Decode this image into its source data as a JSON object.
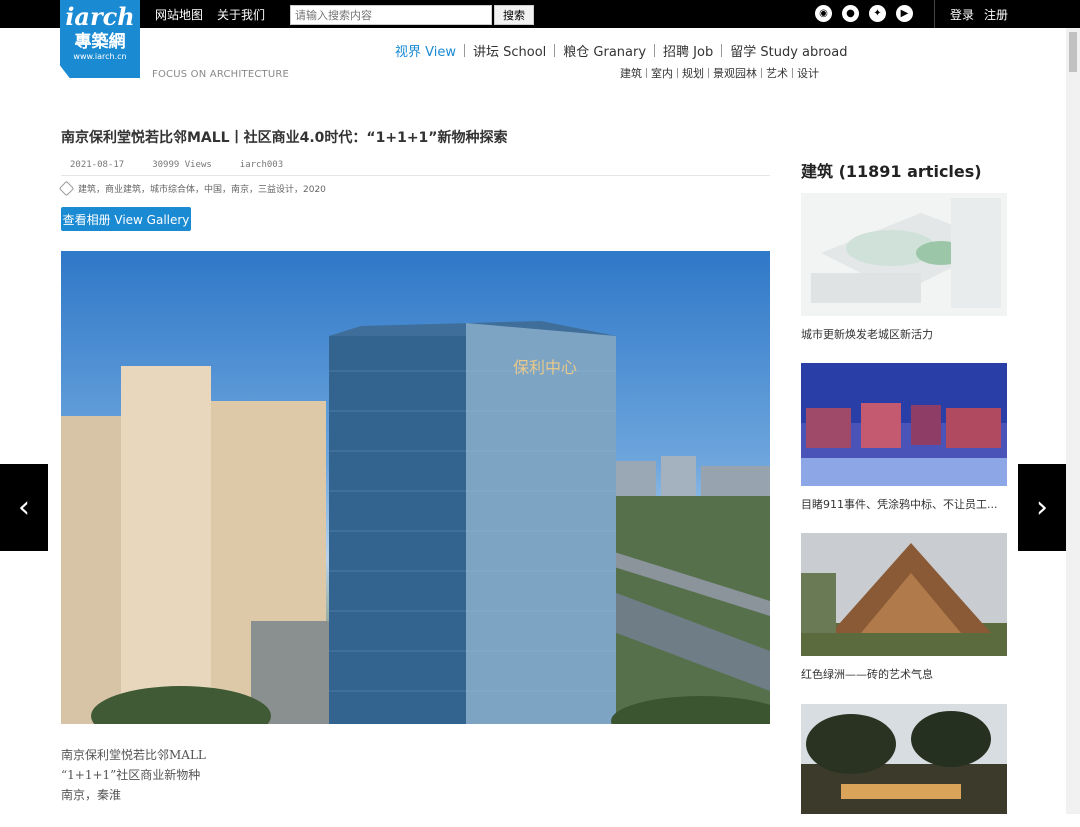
{
  "topbar": {
    "links": [
      "网站地图",
      "关于我们"
    ],
    "search_placeholder": "请输入搜索内容",
    "search_button": "搜索",
    "login": "登录",
    "register": "注册"
  },
  "logo": {
    "text1": "iarch",
    "text2": "專築網",
    "text3": "www.iarch.cn",
    "tagline": "FOCUS ON ARCHITECTURE"
  },
  "mainnav": [
    "视界 View",
    "讲坛 School",
    "粮仓 Granary",
    "招聘 Job",
    "留学 Study abroad"
  ],
  "subnav": [
    "建筑",
    "室内",
    "规划",
    "景观园林",
    "艺术",
    "设计"
  ],
  "article": {
    "title": "南京保利堂悦若比邻MALL丨社区商业4.0时代：“1+1+1”新物种探索",
    "date": "2021-08-17",
    "views": "30999 Views",
    "author": "iarch003",
    "tags": "建筑，商业建筑，城市综合体，中国，南京，三益设计，2020",
    "gallery_button": "查看相册 View Gallery",
    "caption_lines": [
      "南京保利堂悦若比邻MALL",
      "“1+1+1”社区商业新物种",
      "南京，秦淮"
    ]
  },
  "sidebar": {
    "heading": "建筑 (11891 articles)",
    "cards": [
      {
        "caption": "城市更新焕发老城区新活力"
      },
      {
        "caption": "目睹911事件、凭涂鸦中标、不让员工..."
      },
      {
        "caption": "红色绿洲——砖的艺术气息"
      },
      {
        "caption": ""
      }
    ]
  },
  "nav_arrows": {
    "prev": "‹",
    "next": "›"
  }
}
